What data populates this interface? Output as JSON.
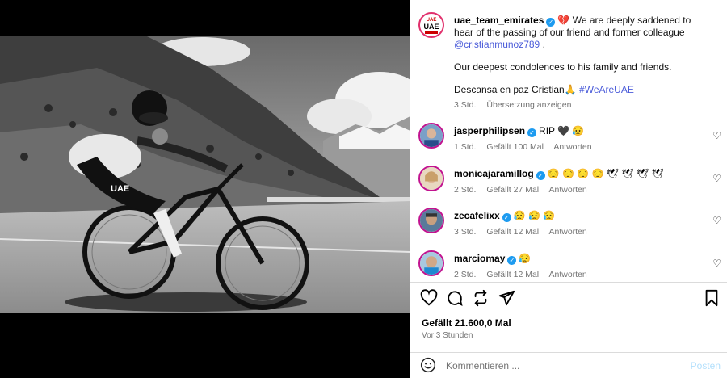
{
  "caption": {
    "username": "uae_team_emirates",
    "logo_text_top": "UAE",
    "logo_text_mid": "UAE",
    "line1": "We are deeply saddened to hear of the passing of our friend and former colleague",
    "mention": "@cristianmunoz789",
    "line1_end": ".",
    "line2": "Our deepest condolences to his family and friends.",
    "line3": "Descansa en paz Cristian",
    "hashtag": "#WeAreUAE",
    "time": "3 Std.",
    "translate": "Übersetzung anzeigen"
  },
  "comments": [
    {
      "username": "jasperphilipsen",
      "text": "RIP 🖤 😥",
      "time": "1 Std.",
      "likes": "Gefällt 100 Mal",
      "reply": "Antworten"
    },
    {
      "username": "monicajaramillog",
      "text": "😔 😔 😔 😔 🕊 🕊 🕊 🕊",
      "time": "2 Std.",
      "likes": "Gefällt 27 Mal",
      "reply": "Antworten"
    },
    {
      "username": "zecafelixx",
      "text": "😥 😥 😥",
      "time": "3 Std.",
      "likes": "Gefällt 12 Mal",
      "reply": "Antworten"
    },
    {
      "username": "marciomay",
      "text": "😥",
      "time": "2 Std.",
      "likes": "Gefällt 12 Mal",
      "reply": "Antworten"
    }
  ],
  "post": {
    "likes": "Gefällt 21.600,0 Mal",
    "time": "Vor 3 Stunden"
  },
  "comment_box": {
    "placeholder": "Kommentieren ...",
    "post_label": "Posten"
  },
  "icons": [
    "heart-icon",
    "comment-icon",
    "repost-icon",
    "share-icon",
    "bookmark-icon",
    "emoji-icon",
    "verified-icon"
  ],
  "colors": {
    "verified": "#1d9bf0",
    "link": "#4a5bd9",
    "post_button": "#b2dffc",
    "meta": "#737373"
  }
}
